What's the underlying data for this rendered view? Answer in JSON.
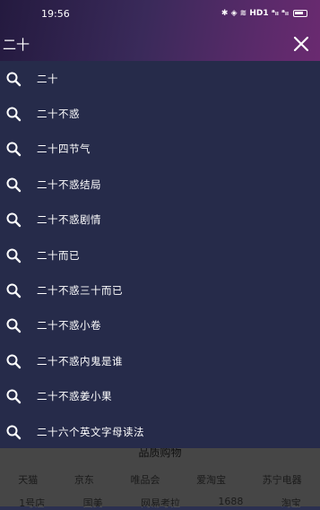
{
  "status_bar": {
    "time": "19:56",
    "indicators": "✱ ◈ ≋ HD1 ᵃᵢₗ ᵃᵢₗ"
  },
  "search": {
    "query": "二十",
    "close_icon": "close-icon"
  },
  "suggestions": [
    {
      "label": "二十"
    },
    {
      "label": "二十不惑"
    },
    {
      "label": "二十四节气"
    },
    {
      "label": "二十不惑结局"
    },
    {
      "label": "二十不惑剧情"
    },
    {
      "label": "二十而已"
    },
    {
      "label": "二十不惑三十而已"
    },
    {
      "label": "二十不惑小卷"
    },
    {
      "label": "二十不惑内鬼是谁"
    },
    {
      "label": "二十不惑姜小果"
    },
    {
      "label": "二十六个英文字母读法"
    }
  ],
  "background_page": {
    "section_title": "品质购物",
    "row1": [
      "天猫",
      "京东",
      "唯品会",
      "爱淘宝",
      "苏宁电器"
    ],
    "row2": [
      "1号店",
      "国美",
      "网易考拉",
      "1688",
      "淘宝"
    ]
  },
  "colors": {
    "list_bg": "#262b4a",
    "header_gradient_start": "#241a3f",
    "header_gradient_end": "#6a2a70"
  }
}
